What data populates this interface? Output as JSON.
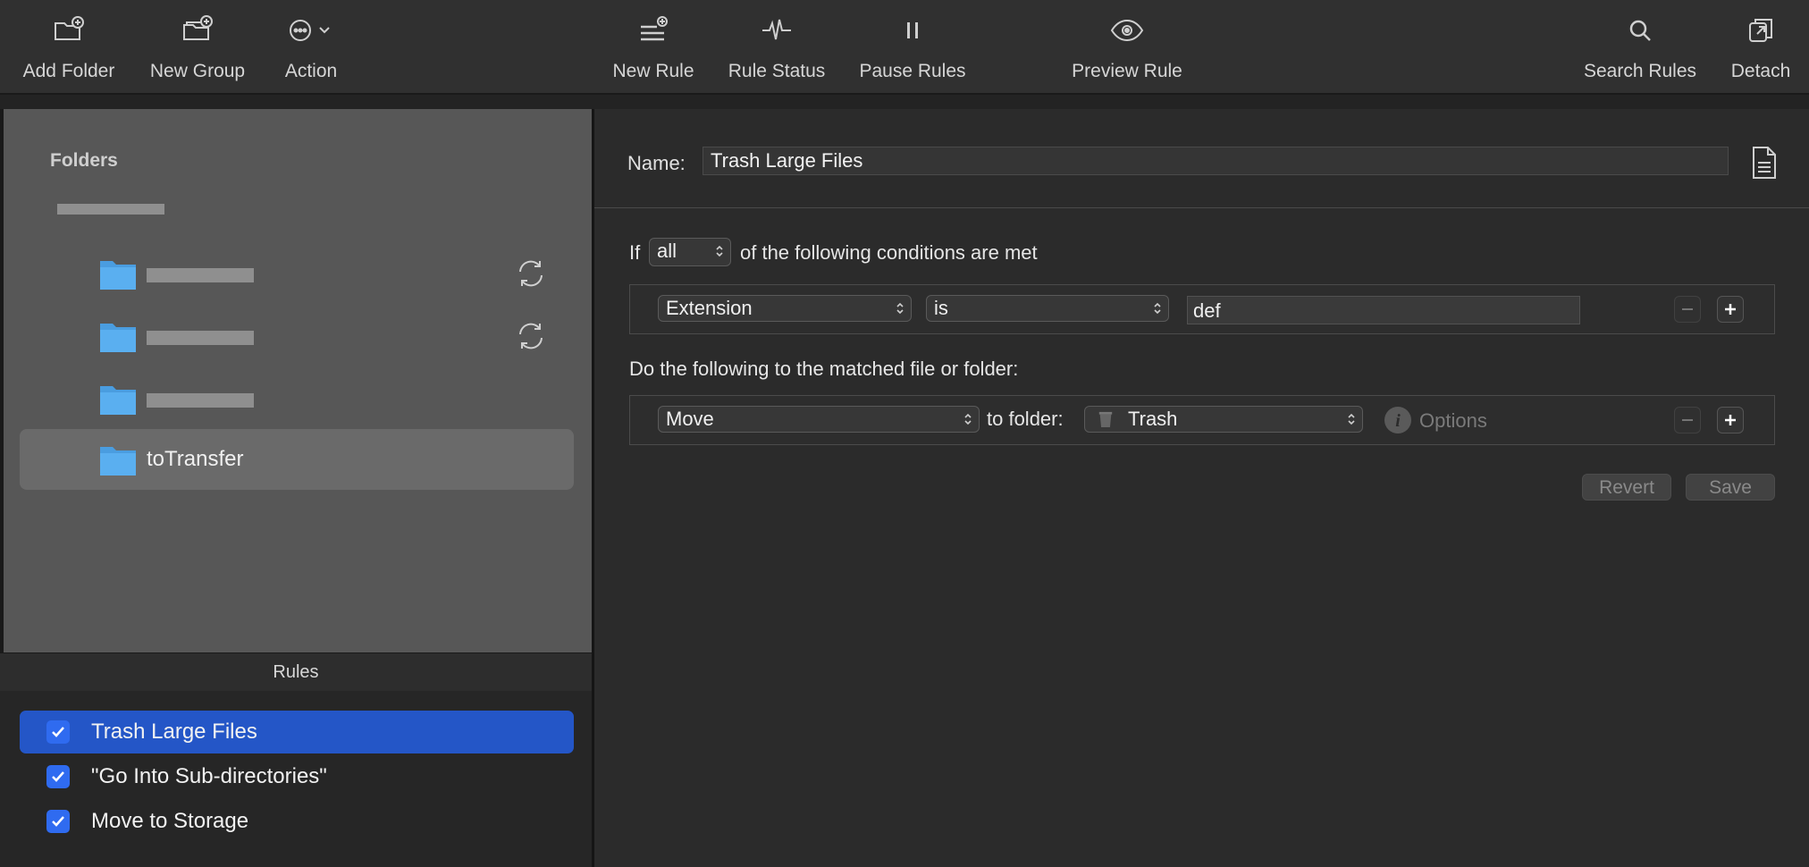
{
  "toolbar": {
    "add_folder": "Add Folder",
    "new_group": "New Group",
    "action": "Action",
    "new_rule": "New Rule",
    "rule_status": "Rule Status",
    "pause_rules": "Pause Rules",
    "preview_rule": "Preview Rule",
    "search_rules": "Search Rules",
    "detach": "Detach"
  },
  "sidebar": {
    "header": "Folders",
    "folders": [
      {
        "name": "toTransfer",
        "selected": true
      }
    ]
  },
  "rules": {
    "header": "Rules",
    "items": [
      {
        "label": "Trash Large Files",
        "checked": true,
        "selected": true
      },
      {
        "label": "\"Go Into Sub-directories\"",
        "checked": true,
        "selected": false
      },
      {
        "label": "Move to Storage",
        "checked": true,
        "selected": false
      }
    ]
  },
  "editor": {
    "name_label": "Name:",
    "name_value": "Trash Large Files",
    "if_label": "If",
    "match_mode": "all",
    "conditions_text": "of the following conditions are met",
    "condition": {
      "attribute": "Extension",
      "operator": "is",
      "value": "def"
    },
    "actions_text": "Do the following to the matched file or folder:",
    "action": {
      "type": "Move",
      "to_folder_label": "to folder:",
      "folder": "Trash",
      "options_label": "Options"
    },
    "revert": "Revert",
    "save": "Save"
  },
  "colors": {
    "selection_blue": "#2456c7",
    "checkbox_blue": "#2f6bf0",
    "folder_blue": "#5aaff0"
  }
}
